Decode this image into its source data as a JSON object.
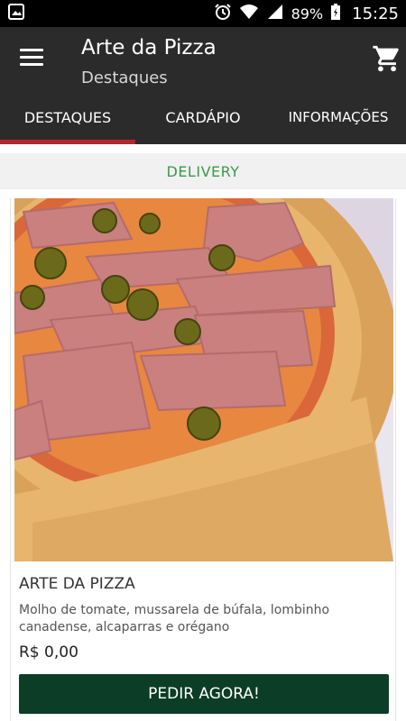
{
  "status_bar": {
    "battery": "89%",
    "time": "15:25",
    "icons": [
      "image-icon",
      "alarm-icon",
      "wifi-icon",
      "signal-icon",
      "battery-icon"
    ]
  },
  "appbar": {
    "title": "Arte da Pizza",
    "subtitle": "Destaques",
    "icons": [
      "menu-icon",
      "cart-icon"
    ]
  },
  "tabs": [
    {
      "label": "DESTAQUES",
      "active": true
    },
    {
      "label": "CARDÁPIO",
      "active": false
    },
    {
      "label": "INFORMAÇÕES",
      "active": false
    }
  ],
  "delivery_label": "DELIVERY",
  "product": {
    "name": "ARTE DA PIZZA",
    "description": "Molho de tomate, mussarela de búfala, lombinho canadense, alcaparras e orégano",
    "price": "R$ 0,00",
    "button_label": "PEDIR AGORA!"
  },
  "colors": {
    "appbar": "#2b2b2b",
    "tab_indicator": "#b3262d",
    "delivery_text": "#3a9a48",
    "order_button": "#0c3d27"
  }
}
